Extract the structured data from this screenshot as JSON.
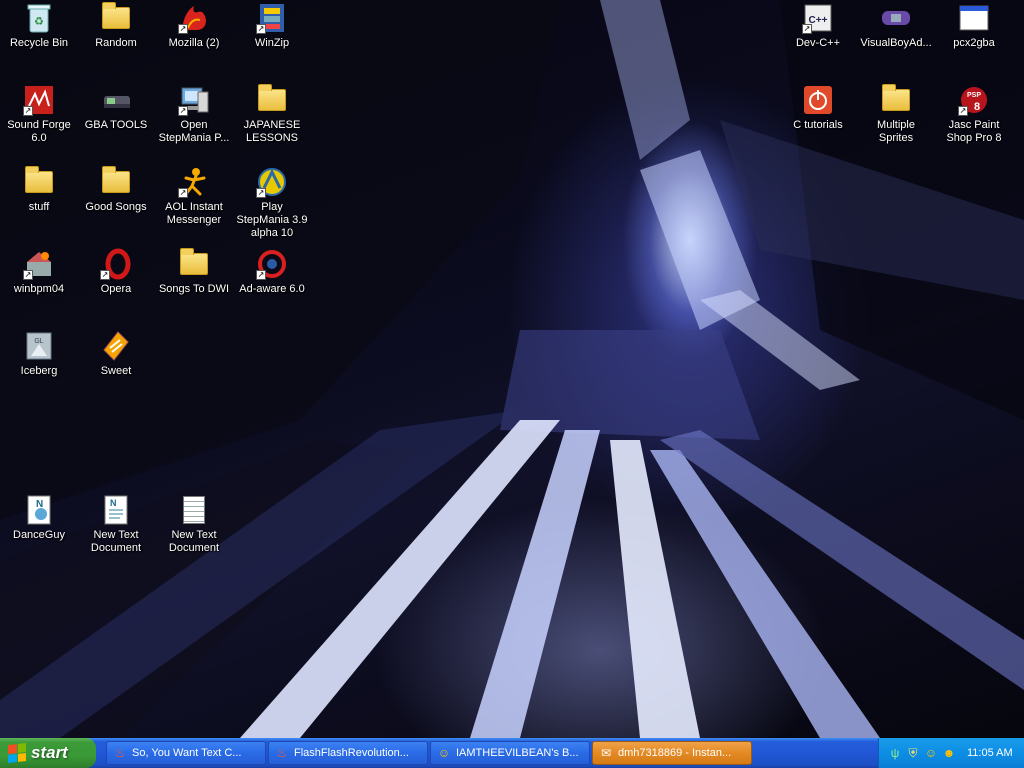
{
  "desktop": {
    "icons": [
      {
        "label": "Recycle Bin",
        "icon": "recycle-bin-icon"
      },
      {
        "label": "Random",
        "icon": "folder-icon"
      },
      {
        "label": "Mozilla (2)",
        "icon": "mozilla-icon"
      },
      {
        "label": "WinZip",
        "icon": "winzip-icon"
      },
      {
        "label": "Sound Forge 6.0",
        "icon": "sound-forge-icon"
      },
      {
        "label": "GBA TOOLS",
        "icon": "gba-tools-icon"
      },
      {
        "label": "Open StepMania P...",
        "icon": "computer-icon"
      },
      {
        "label": "JAPANESE LESSONS",
        "icon": "folder-icon"
      },
      {
        "label": "stuff",
        "icon": "folder-icon"
      },
      {
        "label": "Good Songs",
        "icon": "folder-icon"
      },
      {
        "label": "AOL Instant Messenger",
        "icon": "aim-icon"
      },
      {
        "label": "Play StepMania 3.9 alpha 10",
        "icon": "stepmania-icon"
      },
      {
        "label": "winbpm04",
        "icon": "winbpm-icon"
      },
      {
        "label": "Opera",
        "icon": "opera-icon"
      },
      {
        "label": "Songs To DWI",
        "icon": "folder-icon"
      },
      {
        "label": "Ad-aware 6.0",
        "icon": "adaware-icon"
      },
      {
        "label": "Iceberg",
        "icon": "iceberg-icon"
      },
      {
        "label": "Sweet",
        "icon": "winamp-icon"
      },
      {
        "label": "DanceGuy",
        "icon": "danceguy-icon"
      },
      {
        "label": "New Text Document",
        "icon": "text-document-icon"
      },
      {
        "label": "New Text Document",
        "icon": "text-document-icon"
      },
      {
        "label": "Dev-C++",
        "icon": "dev-cpp-icon"
      },
      {
        "label": "VisualBoyAd...",
        "icon": "visualboyadvance-icon"
      },
      {
        "label": "pcx2gba",
        "icon": "application-icon"
      },
      {
        "label": "C tutorials",
        "icon": "power-icon"
      },
      {
        "label": "Multiple Sprites",
        "icon": "folder-icon"
      },
      {
        "label": "Jasc Paint Shop Pro 8",
        "icon": "paint-shop-pro-icon"
      }
    ]
  },
  "taskbar": {
    "start_label": "start",
    "tasks": [
      {
        "label": "So, You Want Text C...",
        "icon": "mozilla-icon",
        "active": false
      },
      {
        "label": "FlashFlashRevolution...",
        "icon": "mozilla-icon",
        "active": false
      },
      {
        "label": "IAMTHEEVILBEAN's B...",
        "icon": "aim-icon",
        "active": false
      },
      {
        "label": "dmh7318869 - Instan...",
        "icon": "aim-chat-icon",
        "active": true
      }
    ],
    "tray": {
      "icons": [
        "network-icon",
        "security-icon",
        "aim-tray-icon",
        "aim-tray-icon-2"
      ],
      "clock": "11:05 AM"
    }
  },
  "colors": {
    "taskbar_blue": "#245edb",
    "start_green": "#3c9a38",
    "tray_blue": "#0d8ee6",
    "active_task_orange": "#e38a24"
  }
}
